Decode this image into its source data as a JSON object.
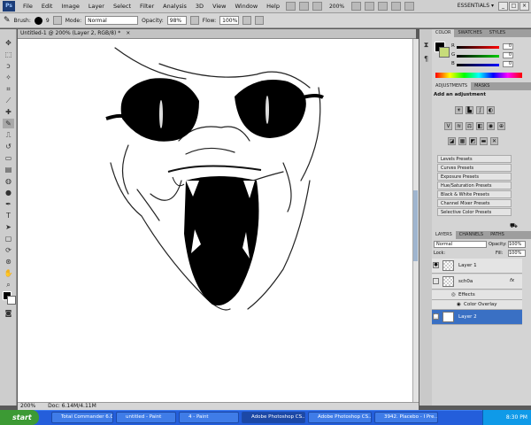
{
  "menubar": {
    "logo": "Ps",
    "items": [
      "File",
      "Edit",
      "Image",
      "Layer",
      "Select",
      "Filter",
      "Analysis",
      "3D",
      "View",
      "Window",
      "Help"
    ],
    "zoom": "200%",
    "workspace": "ESSENTIALS ▾",
    "window_buttons": [
      "_",
      "□",
      "×"
    ]
  },
  "options": {
    "brush_label": "Brush:",
    "brush_size": "9",
    "mode_label": "Mode:",
    "mode_value": "Normal",
    "opacity_label": "Opacity:",
    "opacity_value": "98%",
    "flow_label": "Flow:",
    "flow_value": "100%"
  },
  "document": {
    "tab_title": "Untitled-1 @ 200% (Layer 2, RGB/8) *",
    "tab_close": "×"
  },
  "status": {
    "zoom": "200%",
    "doc": "Doc: 6.14M/4.11M"
  },
  "color_panel": {
    "tabs": [
      "COLOR",
      "SWATCHES",
      "STYLES"
    ],
    "channels": [
      {
        "label": "R",
        "value": "0"
      },
      {
        "label": "G",
        "value": "0"
      },
      {
        "label": "B",
        "value": "0"
      }
    ]
  },
  "adjustments_panel": {
    "tabs": [
      "ADJUSTMENTS",
      "MASKS"
    ],
    "heading": "Add an adjustment",
    "presets": [
      "Levels Presets",
      "Curves Presets",
      "Exposure Presets",
      "Hue/Saturation Presets",
      "Black & White Presets",
      "Channel Mixer Presets",
      "Selective Color Presets"
    ]
  },
  "layers_panel": {
    "tabs": [
      "LAYERS",
      "CHANNELS",
      "PATHS"
    ],
    "blend_mode": "Normal",
    "opacity_label": "Opacity:",
    "opacity_value": "100%",
    "lock_label": "Lock:",
    "fill_label": "Fill:",
    "fill_value": "100%",
    "layers": [
      {
        "name": "Layer 1"
      },
      {
        "name": "sch0a",
        "fx": "fx"
      },
      {
        "name": "Effects"
      },
      {
        "name": "Color Overlay"
      },
      {
        "name": "Layer 2"
      }
    ]
  },
  "taskbar": {
    "start": "start",
    "items": [
      "Total Commander 6.0...",
      "untitled - Paint",
      "4 - Paint",
      "Adobe Photoshop CS...",
      "Adobe Photoshop CS...",
      "3942. Placebo - I Pre..."
    ],
    "clock": "8:30 PM"
  }
}
